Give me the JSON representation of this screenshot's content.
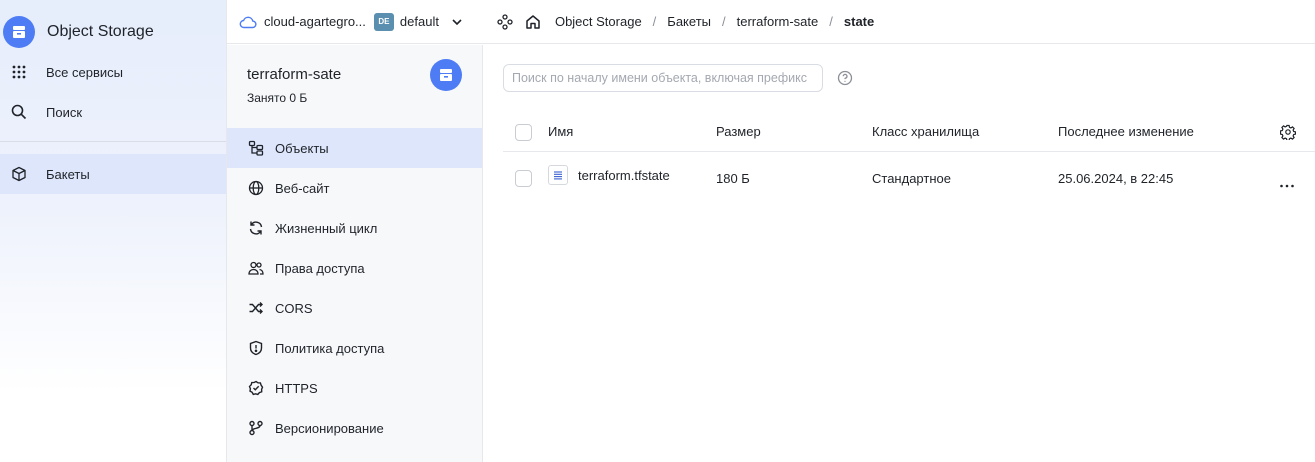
{
  "service": {
    "title": "Object Storage"
  },
  "global_nav": [
    {
      "label": "Все сервисы",
      "icon": "grid-icon"
    },
    {
      "label": "Поиск",
      "icon": "search-icon"
    },
    {
      "label": "Бакеты",
      "icon": "cube-icon",
      "active": true
    }
  ],
  "topbar": {
    "cloud": "cloud-agartegro...",
    "badge": "DE",
    "folder": "default",
    "breadcrumbs": [
      "Object Storage",
      "Бакеты",
      "terraform-sate",
      "state"
    ]
  },
  "bucket": {
    "name": "terraform-sate",
    "used": "Занято 0 Б",
    "menu": [
      {
        "label": "Объекты",
        "icon": "objects-icon",
        "active": true
      },
      {
        "label": "Веб-сайт",
        "icon": "globe-icon"
      },
      {
        "label": "Жизненный цикл",
        "icon": "cycle-icon"
      },
      {
        "label": "Права доступа",
        "icon": "users-icon"
      },
      {
        "label": "CORS",
        "icon": "shuffle-icon"
      },
      {
        "label": "Политика доступа",
        "icon": "shield-icon"
      },
      {
        "label": "HTTPS",
        "icon": "badge-check-icon"
      },
      {
        "label": "Версионирование",
        "icon": "branch-icon"
      }
    ]
  },
  "search": {
    "placeholder": "Поиск по началу имени объекта, включая префикс"
  },
  "table": {
    "columns": [
      "Имя",
      "Размер",
      "Класс хранилища",
      "Последнее изменение"
    ],
    "rows": [
      {
        "name": "terraform.tfstate",
        "size": "180 Б",
        "storage_class": "Стандартное",
        "modified": "25.06.2024, в 22:45"
      }
    ]
  },
  "colors": {
    "accent": "#4d7cf5",
    "active_bg": "#dde6fb",
    "badge": "#5a8fb0"
  }
}
